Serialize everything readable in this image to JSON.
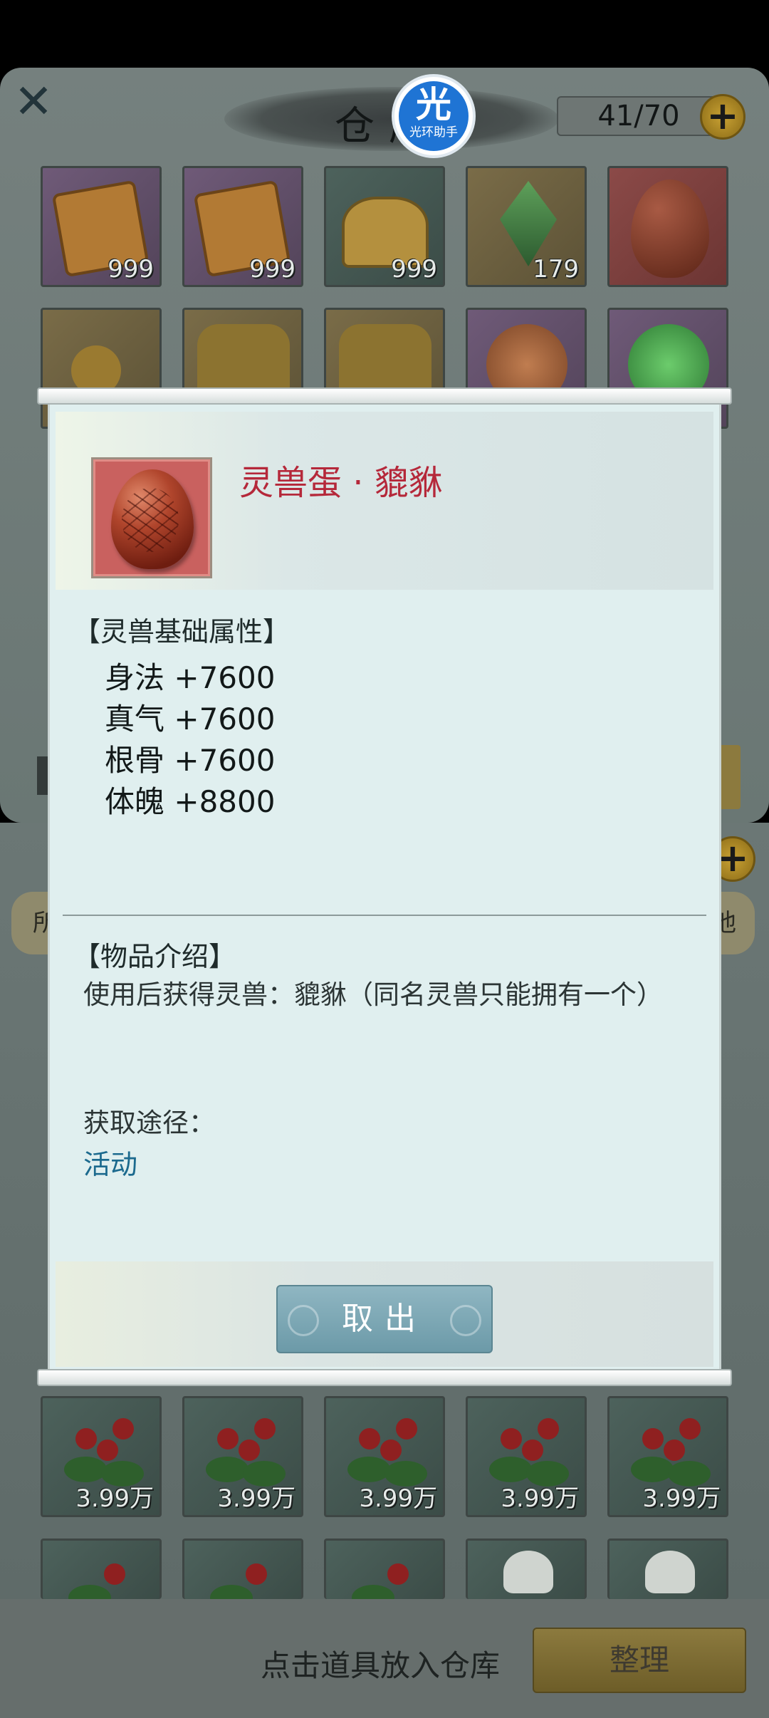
{
  "warehouse": {
    "title": "仓库",
    "capacity": "41/70",
    "close_glyph": "✕",
    "plus_glyph": "+"
  },
  "assistant": {
    "glyph": "光",
    "label": "光环助手"
  },
  "warehouse_items": [
    {
      "icon": "scroll-icon",
      "count": "999"
    },
    {
      "icon": "scroll-icon",
      "count": "999"
    },
    {
      "icon": "gift-box-icon",
      "count": "999"
    },
    {
      "icon": "green-crystal-icon",
      "count": "179"
    },
    {
      "icon": "spirit-egg-icon",
      "count": ""
    }
  ],
  "bag_items": [
    {
      "icon": "red-flower-icon",
      "count": "3.99万"
    },
    {
      "icon": "red-flower-icon",
      "count": "3.99万"
    },
    {
      "icon": "red-flower-icon",
      "count": "3.99万"
    },
    {
      "icon": "red-flower-icon",
      "count": "3.99万"
    },
    {
      "icon": "red-flower-icon",
      "count": "3.99万"
    }
  ],
  "side_tabs": {
    "left": "所",
    "right": "池"
  },
  "bottom": {
    "hint": "点击道具放入仓库",
    "sort_label": "整理"
  },
  "dialog": {
    "item_name": "灵兽蛋 · 貔貅",
    "base_attr_title": "【灵兽基础属性】",
    "stats": [
      {
        "name": "身法",
        "value": "+7600"
      },
      {
        "name": "真气",
        "value": "+7600"
      },
      {
        "name": "根骨",
        "value": "+7600"
      },
      {
        "name": "体魄",
        "value": "+8800"
      }
    ],
    "intro_title": "【物品介绍】",
    "description": "使用后获得灵兽：貔貅（同名灵兽只能拥有一个）",
    "source_label": "获取途径：",
    "source_link": "活动",
    "take_out_label": "取出"
  },
  "colors": {
    "item_name": "#b5283a",
    "source_link": "#1c6a8e",
    "take_button": "#7ea8b5"
  }
}
